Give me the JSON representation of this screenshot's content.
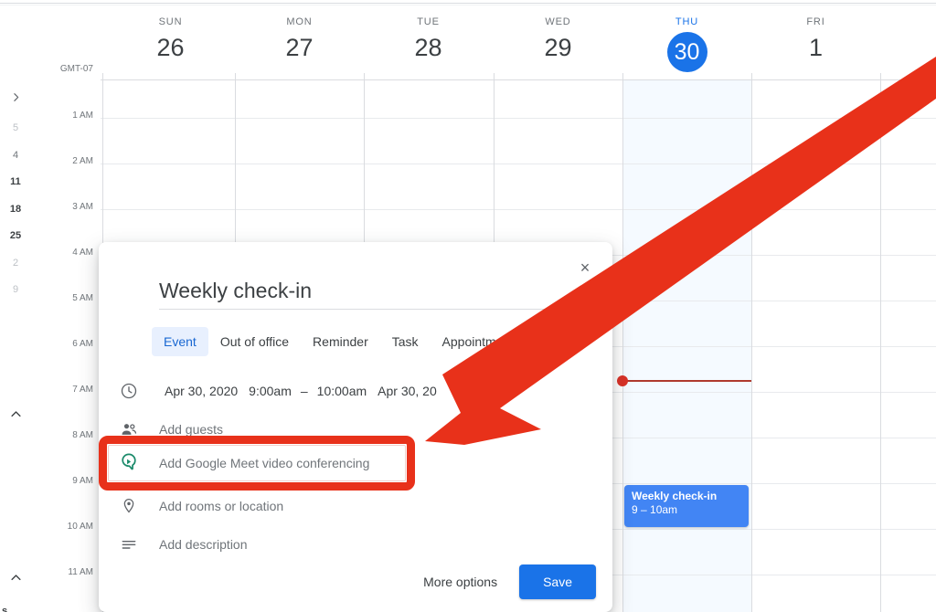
{
  "app": {
    "name": "Google Calendar",
    "timezone_label": "GMT-07"
  },
  "sidebar": {
    "expand_icon": "chevron-right-icon",
    "mini_month_numbers": [
      "5",
      "4",
      "11",
      "18",
      "25",
      "2",
      "9"
    ],
    "collapse_icon_top": "chevron-up-icon",
    "collapse_icon_bottom": "chevron-up-icon",
    "bottom_letter": "s"
  },
  "week": {
    "days": [
      {
        "dow": "SUN",
        "num": "26",
        "today": false
      },
      {
        "dow": "MON",
        "num": "27",
        "today": false
      },
      {
        "dow": "TUE",
        "num": "28",
        "today": false
      },
      {
        "dow": "WED",
        "num": "29",
        "today": false
      },
      {
        "dow": "THU",
        "num": "30",
        "today": true
      },
      {
        "dow": "FRI",
        "num": "1",
        "today": false
      }
    ],
    "hours": [
      "1 AM",
      "2 AM",
      "3 AM",
      "4 AM",
      "5 AM",
      "6 AM",
      "7 AM",
      "8 AM",
      "9 AM",
      "10 AM",
      "11 AM"
    ],
    "today_accent": "#1a73e8",
    "now_line_color": "#d93025"
  },
  "grid_events": [
    {
      "title": "Weekly check-in",
      "time": "9 – 10am",
      "color": "#4285f4"
    }
  ],
  "dialog": {
    "title": "Weekly check-in",
    "close_label": "×",
    "tabs": [
      {
        "label": "Event",
        "active": true
      },
      {
        "label": "Out of office",
        "active": false
      },
      {
        "label": "Reminder",
        "active": false
      },
      {
        "label": "Task",
        "active": false
      },
      {
        "label": "Appointment slots",
        "active": false
      }
    ],
    "datetime": {
      "start_date": "Apr 30, 2020",
      "start_time": "9:00am",
      "separator": "–",
      "end_time": "10:00am",
      "end_date": "Apr 30, 20"
    },
    "rows": [
      {
        "icon": "clock-icon",
        "text": ""
      },
      {
        "icon": "people-icon",
        "text": "Add guests"
      },
      {
        "icon": "google-meet-icon",
        "text": "Add Google Meet video conferencing"
      },
      {
        "icon": "location-pin-icon",
        "text": "Add rooms or location"
      },
      {
        "icon": "description-icon",
        "text": "Add description"
      }
    ],
    "more_options_label": "More options",
    "save_label": "Save"
  },
  "annotation": {
    "highlight_color": "#e8311a",
    "arrow_color": "#e8311a",
    "highlight_target": "Add Google Meet video conferencing"
  }
}
